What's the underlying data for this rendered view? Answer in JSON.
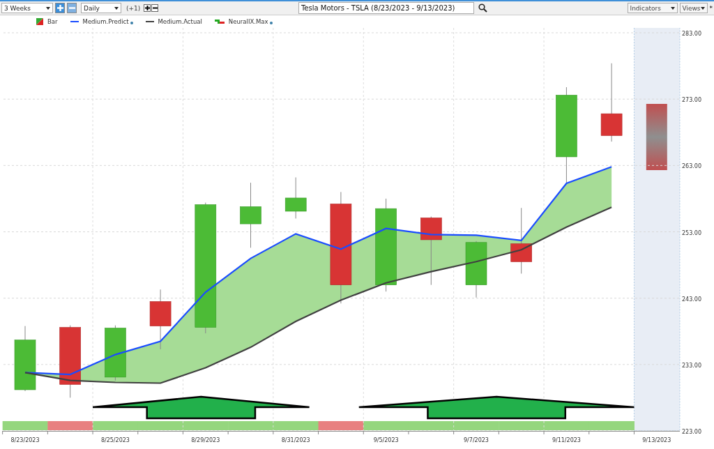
{
  "toolbar": {
    "period": {
      "value": "3 Weeks"
    },
    "interval": {
      "value": "Daily"
    },
    "offset": "(+1)",
    "title": {
      "value": "Tesla Motors - TSLA (8/23/2023 - 9/13/2023)"
    },
    "indicators": {
      "value": "Indicators"
    },
    "views": {
      "value": "Views"
    },
    "views_mark": "*"
  },
  "legend": [
    {
      "kind": "bar",
      "dot": false
    },
    {
      "kind": "line",
      "dot": true
    },
    {
      "kind": "line",
      "dot": false
    },
    {
      "kind": "signal",
      "label": "NeuralIX.Max",
      "dot": true
    }
  ],
  "chart_data": {
    "type": "candlestick",
    "categories": [
      "8/23/2023",
      null,
      "8/25/2023",
      null,
      "8/29/2023",
      null,
      "8/31/2023",
      null,
      "9/5/2023",
      null,
      "9/7/2023",
      null,
      "9/11/2023",
      null,
      "9/13/2023"
    ],
    "yticks": [
      {
        "value": 223,
        "label": "223.00"
      },
      {
        "value": 233,
        "label": "233.00"
      },
      {
        "value": 243,
        "label": "243.00"
      },
      {
        "value": 253,
        "label": "253.00"
      },
      {
        "value": 263,
        "label": "263.00"
      },
      {
        "value": 273,
        "label": "273.00"
      },
      {
        "value": 283,
        "label": "283.00"
      }
    ],
    "ylim": [
      223,
      283
    ],
    "grid": true,
    "series": [
      {
        "name": "Bar",
        "ohlc": [
          [
            229.2,
            238.8,
            229.0,
            236.7
          ],
          [
            238.6,
            238.9,
            228.0,
            230.0
          ],
          [
            231.1,
            238.9,
            230.6,
            238.5
          ],
          [
            242.5,
            244.3,
            235.3,
            238.8
          ],
          [
            238.6,
            257.4,
            237.7,
            257.1
          ],
          [
            254.2,
            260.4,
            250.6,
            256.8
          ],
          [
            256.1,
            261.2,
            255.0,
            258.1
          ],
          [
            257.2,
            259.0,
            242.2,
            245.0
          ],
          [
            245.0,
            258.0,
            244.0,
            256.5
          ],
          [
            255.1,
            255.3,
            245.0,
            251.8
          ],
          [
            245.0,
            251.6,
            243.1,
            251.4
          ],
          [
            251.2,
            256.6,
            246.7,
            248.5
          ],
          [
            264.3,
            274.8,
            260.4,
            273.6
          ],
          [
            270.8,
            278.4,
            266.6,
            267.5
          ],
          null
        ]
      },
      {
        "name": "Medium.Predict",
        "type": "line",
        "color": "#1a4cff",
        "values": [
          231.8,
          231.5,
          234.5,
          236.5,
          243.9,
          249.0,
          252.7,
          250.4,
          253.5,
          252.6,
          252.5,
          251.7,
          260.3,
          262.8,
          null
        ]
      },
      {
        "name": "Medium.Actual",
        "type": "line",
        "color": "#404040",
        "values": [
          231.8,
          230.6,
          230.3,
          230.2,
          232.5,
          235.6,
          239.5,
          242.7,
          245.3,
          247.0,
          248.5,
          250.3,
          253.7,
          256.7,
          null
        ]
      }
    ]
  },
  "signal_band": [
    {
      "kind": "up"
    },
    {
      "kind": "down"
    },
    {
      "kind": "up"
    },
    {
      "kind": "up"
    },
    {
      "kind": "up"
    },
    {
      "kind": "up"
    },
    {
      "kind": "up"
    },
    {
      "kind": "down"
    },
    {
      "kind": "up"
    },
    {
      "kind": "up"
    },
    {
      "kind": "up"
    },
    {
      "kind": "up"
    },
    {
      "kind": "up"
    },
    {
      "kind": "up"
    }
  ]
}
